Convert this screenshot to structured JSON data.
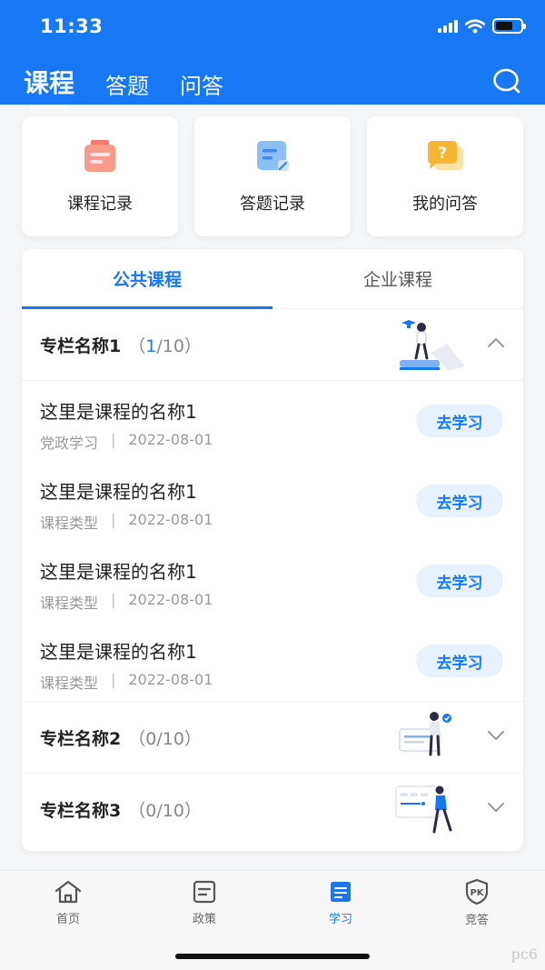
{
  "status": {
    "time": "11:33"
  },
  "header": {
    "tabs": [
      {
        "label": "课程",
        "active": true
      },
      {
        "label": "答题",
        "active": false
      },
      {
        "label": "问答",
        "active": false
      }
    ],
    "search_icon": "search-icon"
  },
  "quick_cards": [
    {
      "label": "课程记录",
      "icon": "clipboard-icon"
    },
    {
      "label": "答题记录",
      "icon": "notes-icon"
    },
    {
      "label": "我的问答",
      "icon": "question-bubble-icon"
    }
  ],
  "segment_tabs": [
    {
      "label": "公共课程",
      "active": true
    },
    {
      "label": "企业课程",
      "active": false
    }
  ],
  "sections": [
    {
      "title": "专栏名称1",
      "count_open": "（",
      "count_current": "1",
      "count_rest": "/10）",
      "expanded": true,
      "courses": [
        {
          "name": "这里是课程的名称1",
          "type": "党政学习",
          "sep": "|",
          "date": "2022-08-01",
          "action": "去学习"
        },
        {
          "name": "这里是课程的名称1",
          "type": "课程类型",
          "sep": "|",
          "date": "2022-08-01",
          "action": "去学习"
        },
        {
          "name": "这里是课程的名称1",
          "type": "课程类型",
          "sep": "|",
          "date": "2022-08-01",
          "action": "去学习"
        },
        {
          "name": "这里是课程的名称1",
          "type": "课程类型",
          "sep": "|",
          "date": "2022-08-01",
          "action": "去学习"
        }
      ]
    },
    {
      "title": "专栏名称2",
      "count": "（0/10）",
      "expanded": false
    },
    {
      "title": "专栏名称3",
      "count": "（0/10）",
      "expanded": false
    }
  ],
  "tabbar": [
    {
      "label": "首页",
      "icon": "home-icon",
      "active": false
    },
    {
      "label": "政策",
      "icon": "document-icon",
      "active": false
    },
    {
      "label": "学习",
      "icon": "study-icon",
      "active": true
    },
    {
      "label": "竞答",
      "icon": "pk-shield-icon",
      "active": false
    }
  ],
  "watermark": "pc6",
  "colors": {
    "primary": "#1877f2",
    "button_bg": "#e7f1ff"
  }
}
